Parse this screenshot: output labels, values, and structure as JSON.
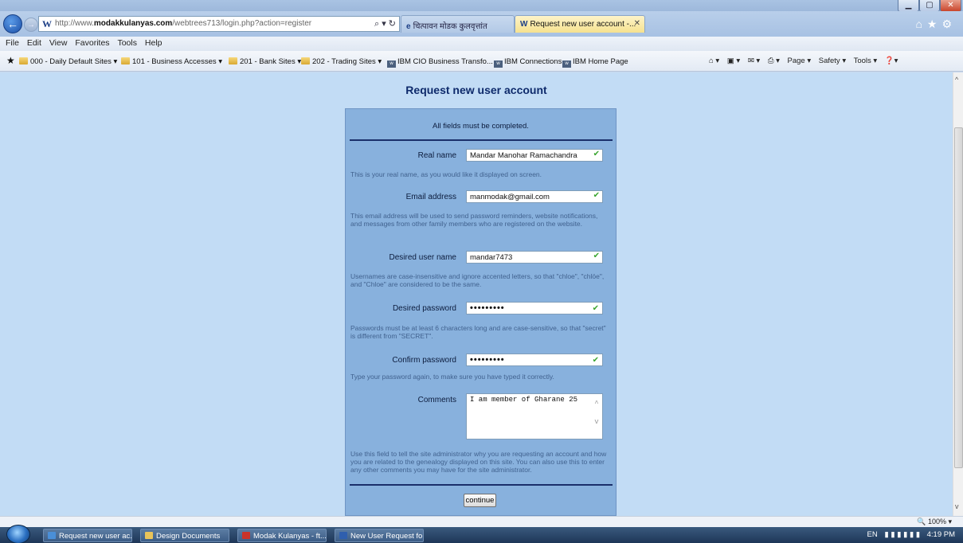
{
  "browser": {
    "url_prefix": "http://www.",
    "url_domain": "modakkulanyas.com",
    "url_path": "/webtrees713/login.php?action=register",
    "tabs": [
      {
        "label": "चित्पावन मोडक कुलवृत्तांत"
      },
      {
        "label": "Request new user account -..."
      }
    ],
    "menu": [
      "File",
      "Edit",
      "View",
      "Favorites",
      "Tools",
      "Help"
    ],
    "favorites": [
      "000 - Daily Default Sites ▾",
      "101 - Business Accesses ▾",
      "201 - Bank Sites ▾",
      "202 - Trading Sites ▾",
      "IBM CIO Business Transfo...",
      "IBM Connections",
      "IBM Home Page"
    ],
    "command_bar": [
      "Page ▾",
      "Safety ▾",
      "Tools ▾"
    ],
    "zoom": "100%"
  },
  "page": {
    "title": "Request new user account",
    "fields_note": "All fields must be completed.",
    "real_name_label": "Real name",
    "real_name_value": "Mandar Manohar Ramachandra",
    "real_name_help": "This is your real name, as you would like it displayed on screen.",
    "email_label": "Email address",
    "email_value": "manmodak@gmail.com",
    "email_help": "This email address will be used to send password reminders, website notifications, and messages from other family members who are registered on the website.",
    "username_label": "Desired user name",
    "username_value": "mandar7473",
    "username_help": "Usernames are case-insensitive and ignore accented letters, so that \"chloe\", \"chlöe\", and \"Chloe\" are considered to be the same.",
    "password_label": "Desired password",
    "password_value": "•••••••••",
    "password_help": "Passwords must be at least 6 characters long and are case-sensitive, so that \"secret\" is different from \"SECRET\".",
    "confirm_label": "Confirm password",
    "confirm_value": "•••••••••",
    "confirm_help": "Type your password again, to make sure you have typed it correctly.",
    "comments_label": "Comments",
    "comments_value": "I am member of Gharane 25",
    "comments_help": "Use this field to tell the site administrator why you are requesting an account and how you are related to the genealogy displayed on this site. You can also use this to enter any other comments you may have for the site administrator.",
    "continue_label": "continue"
  },
  "taskbar": {
    "tasks": [
      "Request new user ac...",
      "Design Documents",
      "Modak Kulanyas - ft...",
      "New User Request fo..."
    ],
    "language": "EN",
    "clock": "4:19 PM"
  },
  "colors": {
    "page_bg": "#c2dcf5",
    "panel_bg": "#88b1dd",
    "title_color": "#0e2a6b",
    "valid_check": "#3aa52f"
  }
}
